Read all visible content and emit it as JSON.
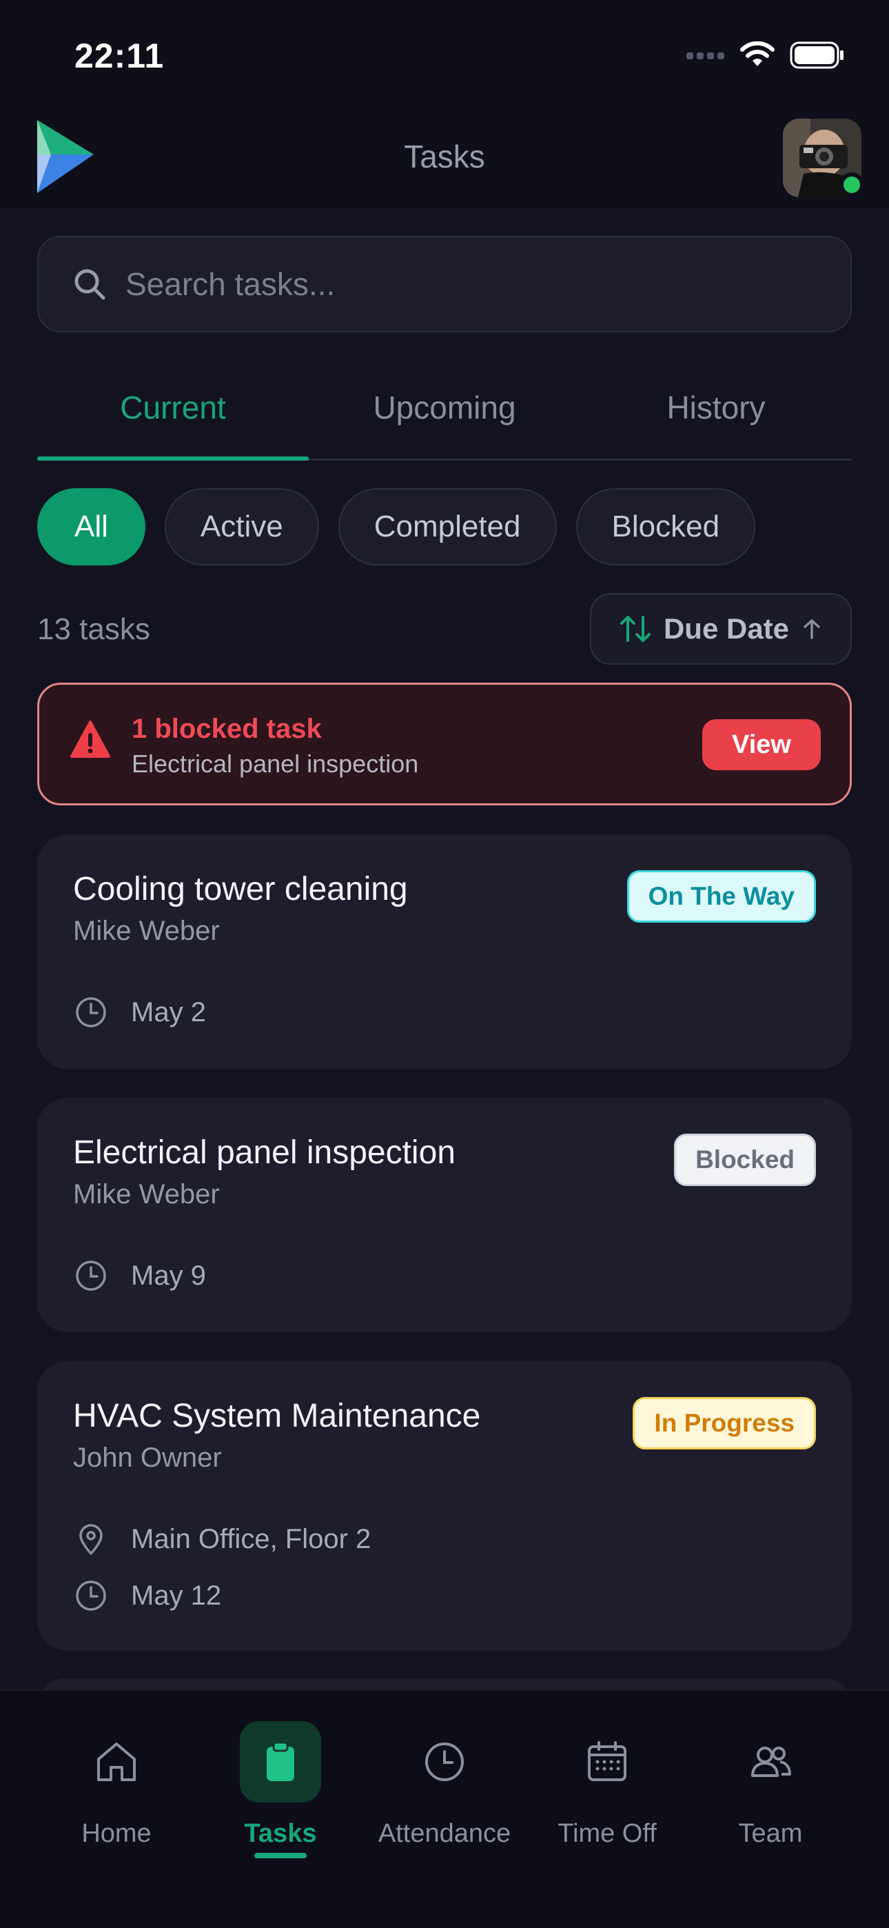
{
  "status_bar": {
    "time": "22:11"
  },
  "header": {
    "title": "Tasks"
  },
  "search": {
    "placeholder": "Search tasks..."
  },
  "tabs": [
    {
      "label": "Current",
      "active": true
    },
    {
      "label": "Upcoming",
      "active": false
    },
    {
      "label": "History",
      "active": false
    }
  ],
  "filters": [
    {
      "label": "All",
      "active": true
    },
    {
      "label": "Active",
      "active": false
    },
    {
      "label": "Completed",
      "active": false
    },
    {
      "label": "Blocked",
      "active": false
    }
  ],
  "summary": {
    "count": "13 tasks",
    "sort_label": "Due Date"
  },
  "alert": {
    "title": "1 blocked task",
    "subtitle": "Electrical panel inspection",
    "button": "View"
  },
  "tasks": [
    {
      "title": "Cooling tower cleaning",
      "assignee": "Mike Weber",
      "status": "On The Way",
      "status_colors": {
        "bg": "#dcfaf9",
        "border": "#3ed6de",
        "text": "#0b8fa0"
      },
      "location": "",
      "due": "May 2"
    },
    {
      "title": "Electrical panel inspection",
      "assignee": "Mike Weber",
      "status": "Blocked",
      "status_colors": {
        "bg": "#f2f3f6",
        "border": "#cfd2d9",
        "text": "#6b6f7c"
      },
      "location": "",
      "due": "May 9"
    },
    {
      "title": "HVAC System Maintenance",
      "assignee": "John Owner",
      "status": "In Progress",
      "status_colors": {
        "bg": "#fef8d9",
        "border": "#f2d35a",
        "text": "#d27c0a"
      },
      "location": "Main Office, Floor 2",
      "due": "May 12"
    }
  ],
  "nav": [
    {
      "label": "Home",
      "icon": "home-icon",
      "active": false
    },
    {
      "label": "Tasks",
      "icon": "clipboard-icon",
      "active": true
    },
    {
      "label": "Attendance",
      "icon": "clock-icon",
      "active": false
    },
    {
      "label": "Time Off",
      "icon": "calendar-icon",
      "active": false
    },
    {
      "label": "Team",
      "icon": "team-icon",
      "active": false
    }
  ],
  "colors": {
    "accent": "#17a678",
    "background": "#131320",
    "card": "#1d1d2c",
    "alert_red": "#e9414a"
  }
}
